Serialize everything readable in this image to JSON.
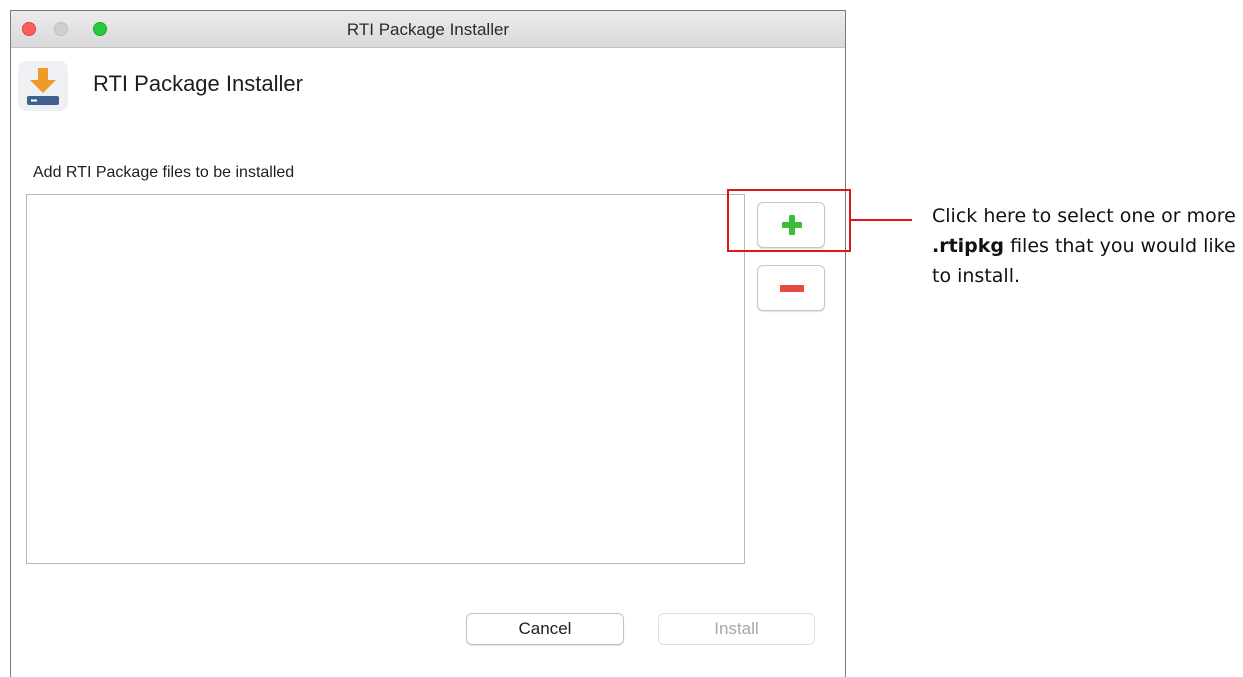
{
  "window": {
    "title": "RTI Package Installer"
  },
  "header": {
    "app_name": "RTI Package Installer",
    "icon": "download-to-drive-icon"
  },
  "file_list": {
    "label": "Add RTI Package files to be installed",
    "items": []
  },
  "side_buttons": {
    "add_icon": "plus-icon",
    "remove_icon": "minus-icon"
  },
  "footer": {
    "cancel_label": "Cancel",
    "install_label": "Install",
    "install_enabled": false
  },
  "annotation": {
    "text_before": "Click here to select one or more ",
    "text_bold": ".rtipkg",
    "text_after": " files that you would like to install."
  },
  "colors": {
    "accent_green": "#3dbe3a",
    "accent_red": "#e84842",
    "annotation_red": "#e0141b",
    "icon_orange": "#f09a2a",
    "icon_drive_blue": "#3f5f8f"
  }
}
